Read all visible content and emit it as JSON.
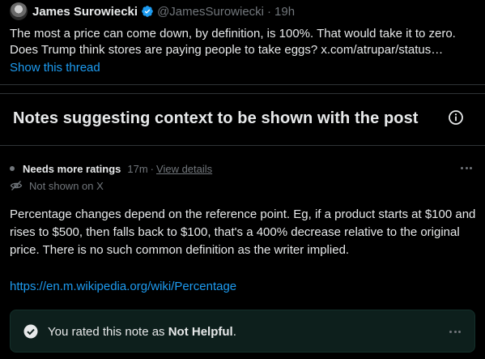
{
  "tweet": {
    "author_name": "James Surowiecki",
    "handle": "@JamesSurowiecki",
    "separator": "·",
    "time": "19h",
    "text_line1": "The most a price can come down, by definition, is 100%. That would take it to zero.",
    "text_line2": "Does Trump think stores are paying people to take eggs? x.com/atrupar/status…",
    "show_thread": "Show this thread"
  },
  "notes_section": {
    "title": "Notes suggesting context to be shown with the post"
  },
  "note": {
    "status_label": "Needs more ratings",
    "time": "17m",
    "separator": "·",
    "view_details": "View details",
    "visibility": "Not shown on X",
    "body": "Percentage changes depend on the reference point. Eg, if a product starts at $100 and rises to $500, then falls back to $100, that's a 400% decrease relative to the original price. There is no such common definition as the writer implied.",
    "link": "https://en.m.wikipedia.org/wiki/Percentage",
    "rating": {
      "prefix": "You rated this note as ",
      "value": "Not Helpful",
      "suffix": "."
    }
  },
  "colors": {
    "accent": "#1d9bf0",
    "rated_bg": "#0d1f1c",
    "muted": "#71767b"
  }
}
